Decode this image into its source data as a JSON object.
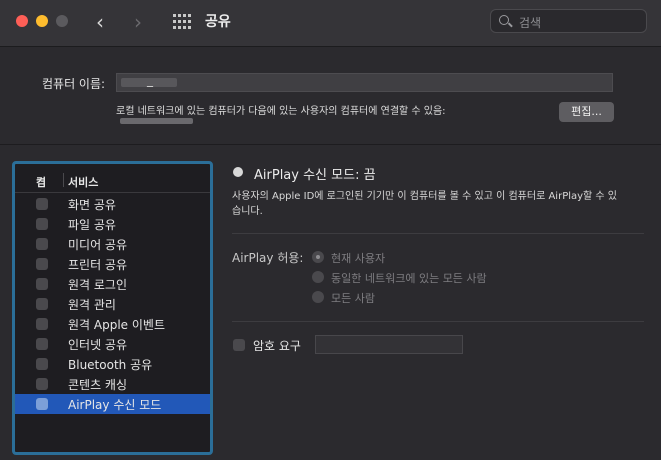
{
  "window": {
    "title": "공유",
    "search_placeholder": "검색"
  },
  "computer": {
    "name_label": "컴퓨터 이름:",
    "name_value": "_",
    "description": "로컬 네트워크에 있는 컴퓨터가 다음에 있는 사용자의 컴퓨터에 연결할 수 있음:",
    "edit_label": "편집..."
  },
  "services": {
    "header_on": "켬",
    "header_service": "서비스",
    "items": [
      {
        "label": "화면 공유"
      },
      {
        "label": "파일 공유"
      },
      {
        "label": "미디어 공유"
      },
      {
        "label": "프린터 공유"
      },
      {
        "label": "원격 로그인"
      },
      {
        "label": "원격 관리"
      },
      {
        "label": "원격 Apple 이벤트"
      },
      {
        "label": "인터넷 공유"
      },
      {
        "label": "Bluetooth 공유"
      },
      {
        "label": "콘텐츠 캐싱"
      },
      {
        "label": "AirPlay 수신 모드"
      }
    ],
    "selected_index": 10
  },
  "detail": {
    "status": "AirPlay 수신 모드: 끔",
    "info": "사용자의 Apple ID에 로그인된 기기만 이 컴퓨터를 볼 수 있고 이 컴퓨터로 AirPlay할 수 있습니다.",
    "allow_label": "AirPlay 허용:",
    "options": [
      "현재 사용자",
      "동일한 네트워크에 있는 모든 사람",
      "모든 사람"
    ],
    "selected_option": 0,
    "password_label": "암호 요구"
  },
  "colors": {
    "accent": "#2258b8",
    "focus_ring": "#2b6e98"
  }
}
